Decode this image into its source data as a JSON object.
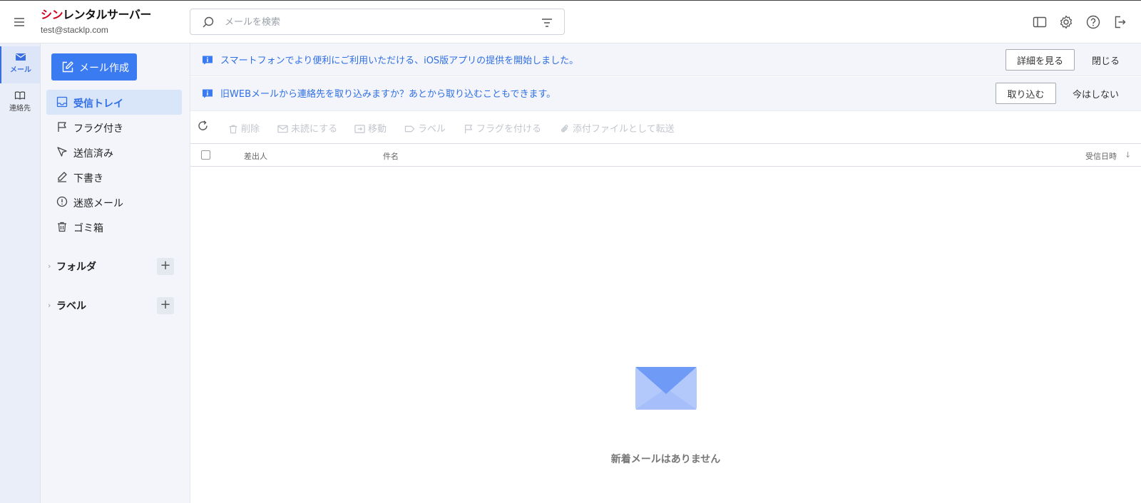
{
  "header": {
    "brand_red": "シン",
    "brand_rest": "レンタルサーバー",
    "account": "test@stacklp.com",
    "search_placeholder": "メールを検索",
    "icons": [
      "layout-icon",
      "gear-icon",
      "help-icon",
      "logout-icon"
    ]
  },
  "rail": {
    "items": [
      {
        "label": "メール",
        "icon": "mail-icon"
      },
      {
        "label": "連絡先",
        "icon": "book-icon"
      }
    ]
  },
  "sidebar": {
    "compose_label": "メール作成",
    "items": [
      {
        "label": "受信トレイ",
        "icon": "inbox-icon"
      },
      {
        "label": "フラグ付き",
        "icon": "flag-icon"
      },
      {
        "label": "送信済み",
        "icon": "send-icon"
      },
      {
        "label": "下書き",
        "icon": "pencil-icon"
      },
      {
        "label": "迷惑メール",
        "icon": "alert-icon"
      },
      {
        "label": "ゴミ箱",
        "icon": "trash-icon"
      }
    ],
    "groups": [
      {
        "label": "フォルダ"
      },
      {
        "label": "ラベル"
      }
    ]
  },
  "notices": [
    {
      "text": "スマートフォンでより便利にご利用いただける、iOS版アプリの提供を開始しました。",
      "button": "詳細を見る",
      "link": "閉じる"
    },
    {
      "text": "旧WEBメールから連絡先を取り込みますか？あとから取り込むこともできます。",
      "button": "取り込む",
      "link": "今はしない"
    }
  ],
  "toolbar": {
    "items": [
      "削除",
      "未読にする",
      "移動",
      "ラベル",
      "フラグを付ける",
      "添付ファイルとして転送"
    ]
  },
  "list_header": {
    "from": "差出人",
    "subject": "件名",
    "date": "受信日時"
  },
  "empty_state": {
    "text": "新着メールはありません"
  },
  "colors": {
    "accent": "#3a7bf2",
    "brand_red": "#d0021b",
    "notice_text": "#2f6ee5"
  }
}
